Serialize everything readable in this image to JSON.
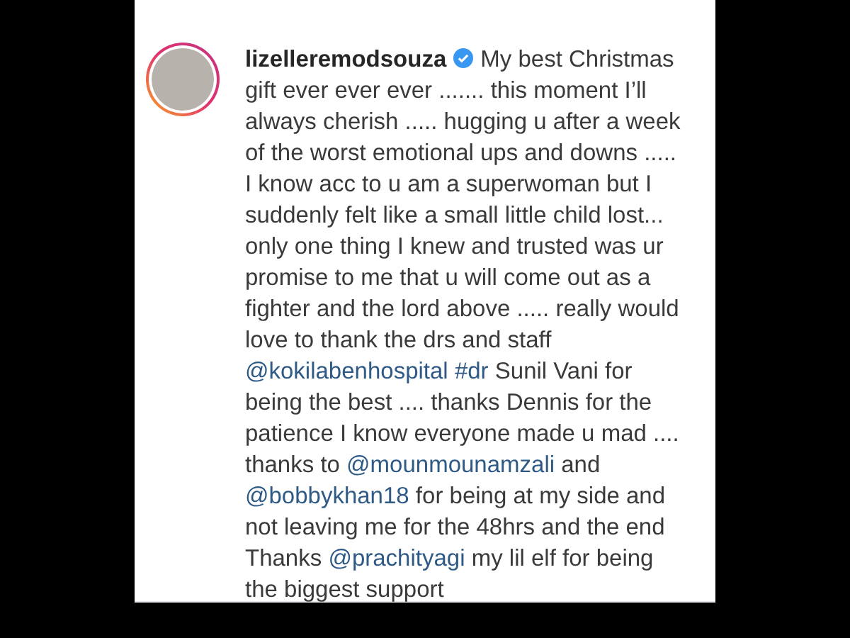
{
  "comment": {
    "username": "lizelleremodsouza",
    "verified": true,
    "segments": [
      {
        "kind": "text",
        "text": "My best Christmas gift ever ever ever ....... this moment I’ll always cherish ..... hugging u after a week of the worst emotional ups and downs ..... I know acc to u am a superwoman but I suddenly felt like a small little child lost... only one thing I knew and trusted was ur promise to me that u will come out as a fighter and the lord above ..... really would love to thank the drs and staff "
      },
      {
        "kind": "link",
        "text": "@kokilabenhospital"
      },
      {
        "kind": "link",
        "text": "#dr"
      },
      {
        "kind": "text",
        "text": " Sunil Vani for being the best .... thanks Dennis for the patience I know everyone made u mad .... thanks to "
      },
      {
        "kind": "link",
        "text": "@mounmounamzali"
      },
      {
        "kind": "text",
        "text": " and "
      },
      {
        "kind": "link",
        "text": "@bobbykhan18"
      },
      {
        "kind": "text",
        "text": " for being at my side and not leaving me for the 48hrs and the end Thanks "
      },
      {
        "kind": "link",
        "text": "@prachityagi"
      },
      {
        "kind": "text",
        "text": " my lil elf for being the biggest support"
      }
    ]
  }
}
